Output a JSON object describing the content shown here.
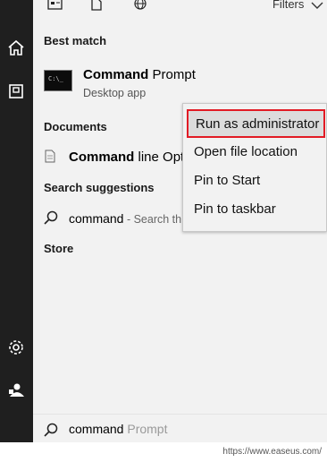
{
  "topbar": {
    "icons": [
      "apps-icon",
      "document-icon",
      "web-icon"
    ],
    "filters_label": "Filters"
  },
  "sidebar": {
    "icons": [
      "home-icon",
      "documents-icon",
      "settings-icon",
      "user-icon"
    ]
  },
  "best_match": {
    "heading": "Best match",
    "app_title_bold": "Command",
    "app_title_rest": " Prompt",
    "app_subtitle": "Desktop app",
    "app_icon_text": "C:\\_"
  },
  "documents": {
    "heading": "Documents",
    "item_bold": "Command",
    "item_rest": " line Opt"
  },
  "search_suggestions": {
    "heading": "Search suggestions",
    "query": "command",
    "hint": " - Search th"
  },
  "store": {
    "heading": "Store"
  },
  "context_menu": {
    "items": [
      "Run as administrator",
      "Open file location",
      "Pin to Start",
      "Pin to taskbar"
    ],
    "highlight_color": "#e21b25"
  },
  "search_box": {
    "typed": "command",
    "completion": " Prompt"
  },
  "watermark": "https://www.easeus.com/"
}
